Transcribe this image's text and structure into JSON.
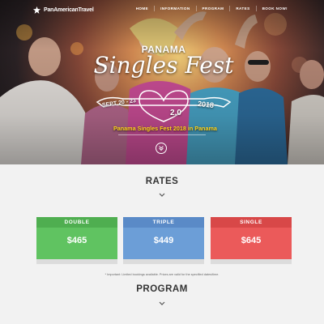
{
  "brand": {
    "logo_text": "PanAmericanTravel"
  },
  "nav": {
    "items": [
      "HOME",
      "INFORMATION",
      "PROGRAM",
      "RATES",
      "BOOK NOW!"
    ]
  },
  "hero": {
    "top_text": "PANAMA",
    "title": "Singles Fest",
    "dates": "SEPT 20 - 23",
    "year": "2018",
    "version": "2.0",
    "caption": "Panama Singles Fest 2018 in Panama"
  },
  "rates": {
    "title": "RATES",
    "cards": [
      {
        "name": "DOUBLE",
        "price": "$465"
      },
      {
        "name": "TRIPLE",
        "price": "$449"
      },
      {
        "name": "SINGLE",
        "price": "$645"
      }
    ],
    "note": "* Important: Limited bookings available. Prices are valid for the specified dates/time."
  },
  "program": {
    "title": "PROGRAM"
  },
  "colors": {
    "double": "#60c361",
    "triple": "#6c9ed7",
    "single": "#eb5a5a",
    "caption": "#ffd51a"
  },
  "icons": {
    "logo": "star-icon",
    "scroll": "double-chevron-down-icon",
    "section_arrow": "chevron-down-icon"
  }
}
